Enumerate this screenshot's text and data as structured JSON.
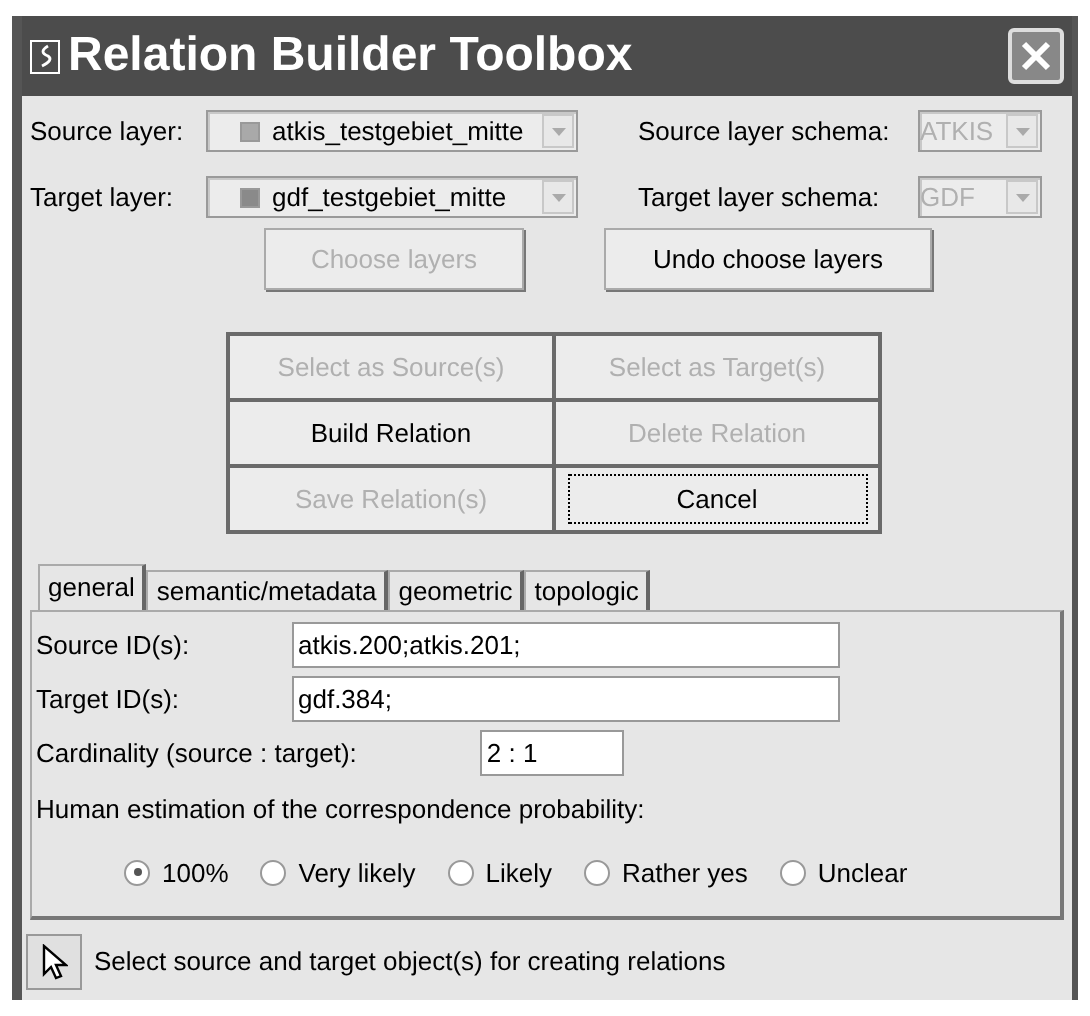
{
  "window": {
    "title": "Relation Builder Toolbox"
  },
  "layers": [
    {
      "label": "Source layer:",
      "value": "atkis_testgebiet_mitte",
      "color": "#a9a9a9",
      "schema_label": "Source layer schema:",
      "schema_value": "ATKIS",
      "schema_disabled": true
    },
    {
      "label": "Target layer:",
      "value": "gdf_testgebiet_mitte",
      "color": "#8a8a8a",
      "schema_label": "Target layer schema:",
      "schema_value": "GDF",
      "schema_disabled": true
    }
  ],
  "layer_buttons": [
    {
      "label": "Choose layers",
      "disabled": true
    },
    {
      "label": "Undo choose layers",
      "disabled": false
    }
  ],
  "relation_buttons": [
    {
      "label": "Select as Source(s)",
      "disabled": true,
      "focused": false
    },
    {
      "label": "Select as Target(s)",
      "disabled": true,
      "focused": false
    },
    {
      "label": "Build Relation",
      "disabled": false,
      "focused": false
    },
    {
      "label": "Delete Relation",
      "disabled": true,
      "focused": false
    },
    {
      "label": "Save Relation(s)",
      "disabled": true,
      "focused": false
    },
    {
      "label": "Cancel",
      "disabled": false,
      "focused": true
    }
  ],
  "tabs": [
    {
      "label": "general",
      "selected": true
    },
    {
      "label": "semantic/metadata",
      "selected": false
    },
    {
      "label": "geometric",
      "selected": false
    },
    {
      "label": "topologic",
      "selected": false
    }
  ],
  "fields": [
    {
      "label": "Source ID(s):",
      "value": "atkis.200;atkis.201;",
      "kind": "wide"
    },
    {
      "label": "Target ID(s):",
      "value": "gdf.384;",
      "kind": "wide"
    },
    {
      "label": "Cardinality (source : target):",
      "value": "2 : 1",
      "kind": "short"
    }
  ],
  "probability": {
    "label": "Human estimation of the correspondence probability:",
    "options": [
      {
        "label": "100%",
        "selected": true
      },
      {
        "label": "Very likely",
        "selected": false
      },
      {
        "label": "Likely",
        "selected": false
      },
      {
        "label": "Rather yes",
        "selected": false
      },
      {
        "label": "Unclear",
        "selected": false
      }
    ]
  },
  "status_bar": {
    "text": "Select source and target object(s) for creating relations"
  }
}
